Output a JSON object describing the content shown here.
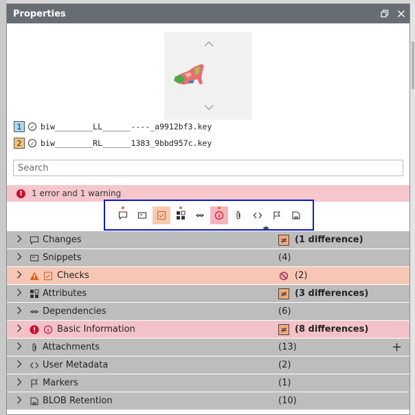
{
  "panel": {
    "title": "Properties",
    "restore_icon": "restore-icon",
    "close_icon": "close-icon"
  },
  "preview": {
    "up_icon": "chevron-up-icon",
    "down_icon": "chevron-down-icon",
    "thumbnail": "car-part-thumbnail"
  },
  "files": [
    {
      "index": "1",
      "name": "biw________LL______----_a9912bf3.key",
      "color": "#a9d7ef"
    },
    {
      "index": "2",
      "name": "biw________RL______1383_9bbd957c.key",
      "color": "#f3c37a"
    }
  ],
  "search": {
    "placeholder": "Search",
    "value": ""
  },
  "alert": {
    "text": "1 error and 1 warning"
  },
  "toolbar": {
    "tools": [
      "changes-icon",
      "snippets-icon",
      "checks-icon",
      "attributes-icon",
      "dependencies-icon",
      "info-icon",
      "attachment-icon",
      "code-icon",
      "flag-icon",
      "blob-icon"
    ]
  },
  "sections": [
    {
      "label": "Changes",
      "value": "(1 difference)",
      "bold": true,
      "neq": true,
      "state": "normal",
      "icon": "comment-icon"
    },
    {
      "label": "Snippets",
      "value": "(4)",
      "bold": false,
      "neq": false,
      "state": "normal",
      "icon": "snippet-icon"
    },
    {
      "label": "Checks",
      "value": "(2)",
      "bold": false,
      "neq": false,
      "state": "warn",
      "icon": "checkbox-icon",
      "status_icon": "warning-icon"
    },
    {
      "label": "Attributes",
      "value": "(3 differences)",
      "bold": true,
      "neq": true,
      "state": "normal",
      "icon": "grid-icon"
    },
    {
      "label": "Dependencies",
      "value": "(6)",
      "bold": false,
      "neq": false,
      "state": "normal",
      "icon": "link-icon"
    },
    {
      "label": "Basic Information",
      "value": "(8 differences)",
      "bold": true,
      "neq": true,
      "state": "err",
      "icon": "info-icon",
      "status_icon": "error-icon"
    },
    {
      "label": "Attachments",
      "value": "(13)",
      "bold": false,
      "neq": false,
      "state": "normal",
      "icon": "paperclip-icon",
      "add": true
    },
    {
      "label": "User Metadata",
      "value": "(2)",
      "bold": false,
      "neq": false,
      "state": "normal",
      "icon": "code-icon"
    },
    {
      "label": "Markers",
      "value": "(1)",
      "bold": false,
      "neq": false,
      "state": "normal",
      "icon": "flag-icon"
    },
    {
      "label": "BLOB Retention",
      "value": "(10)",
      "bold": false,
      "neq": false,
      "state": "normal",
      "icon": "blob-icon"
    }
  ],
  "colors": {
    "titlebar": "#686d74",
    "warn_row": "#f6c7b4",
    "err_row": "#f3c2c8",
    "row": "#bdbdbd",
    "toolbar_border": "#0a17c9"
  }
}
